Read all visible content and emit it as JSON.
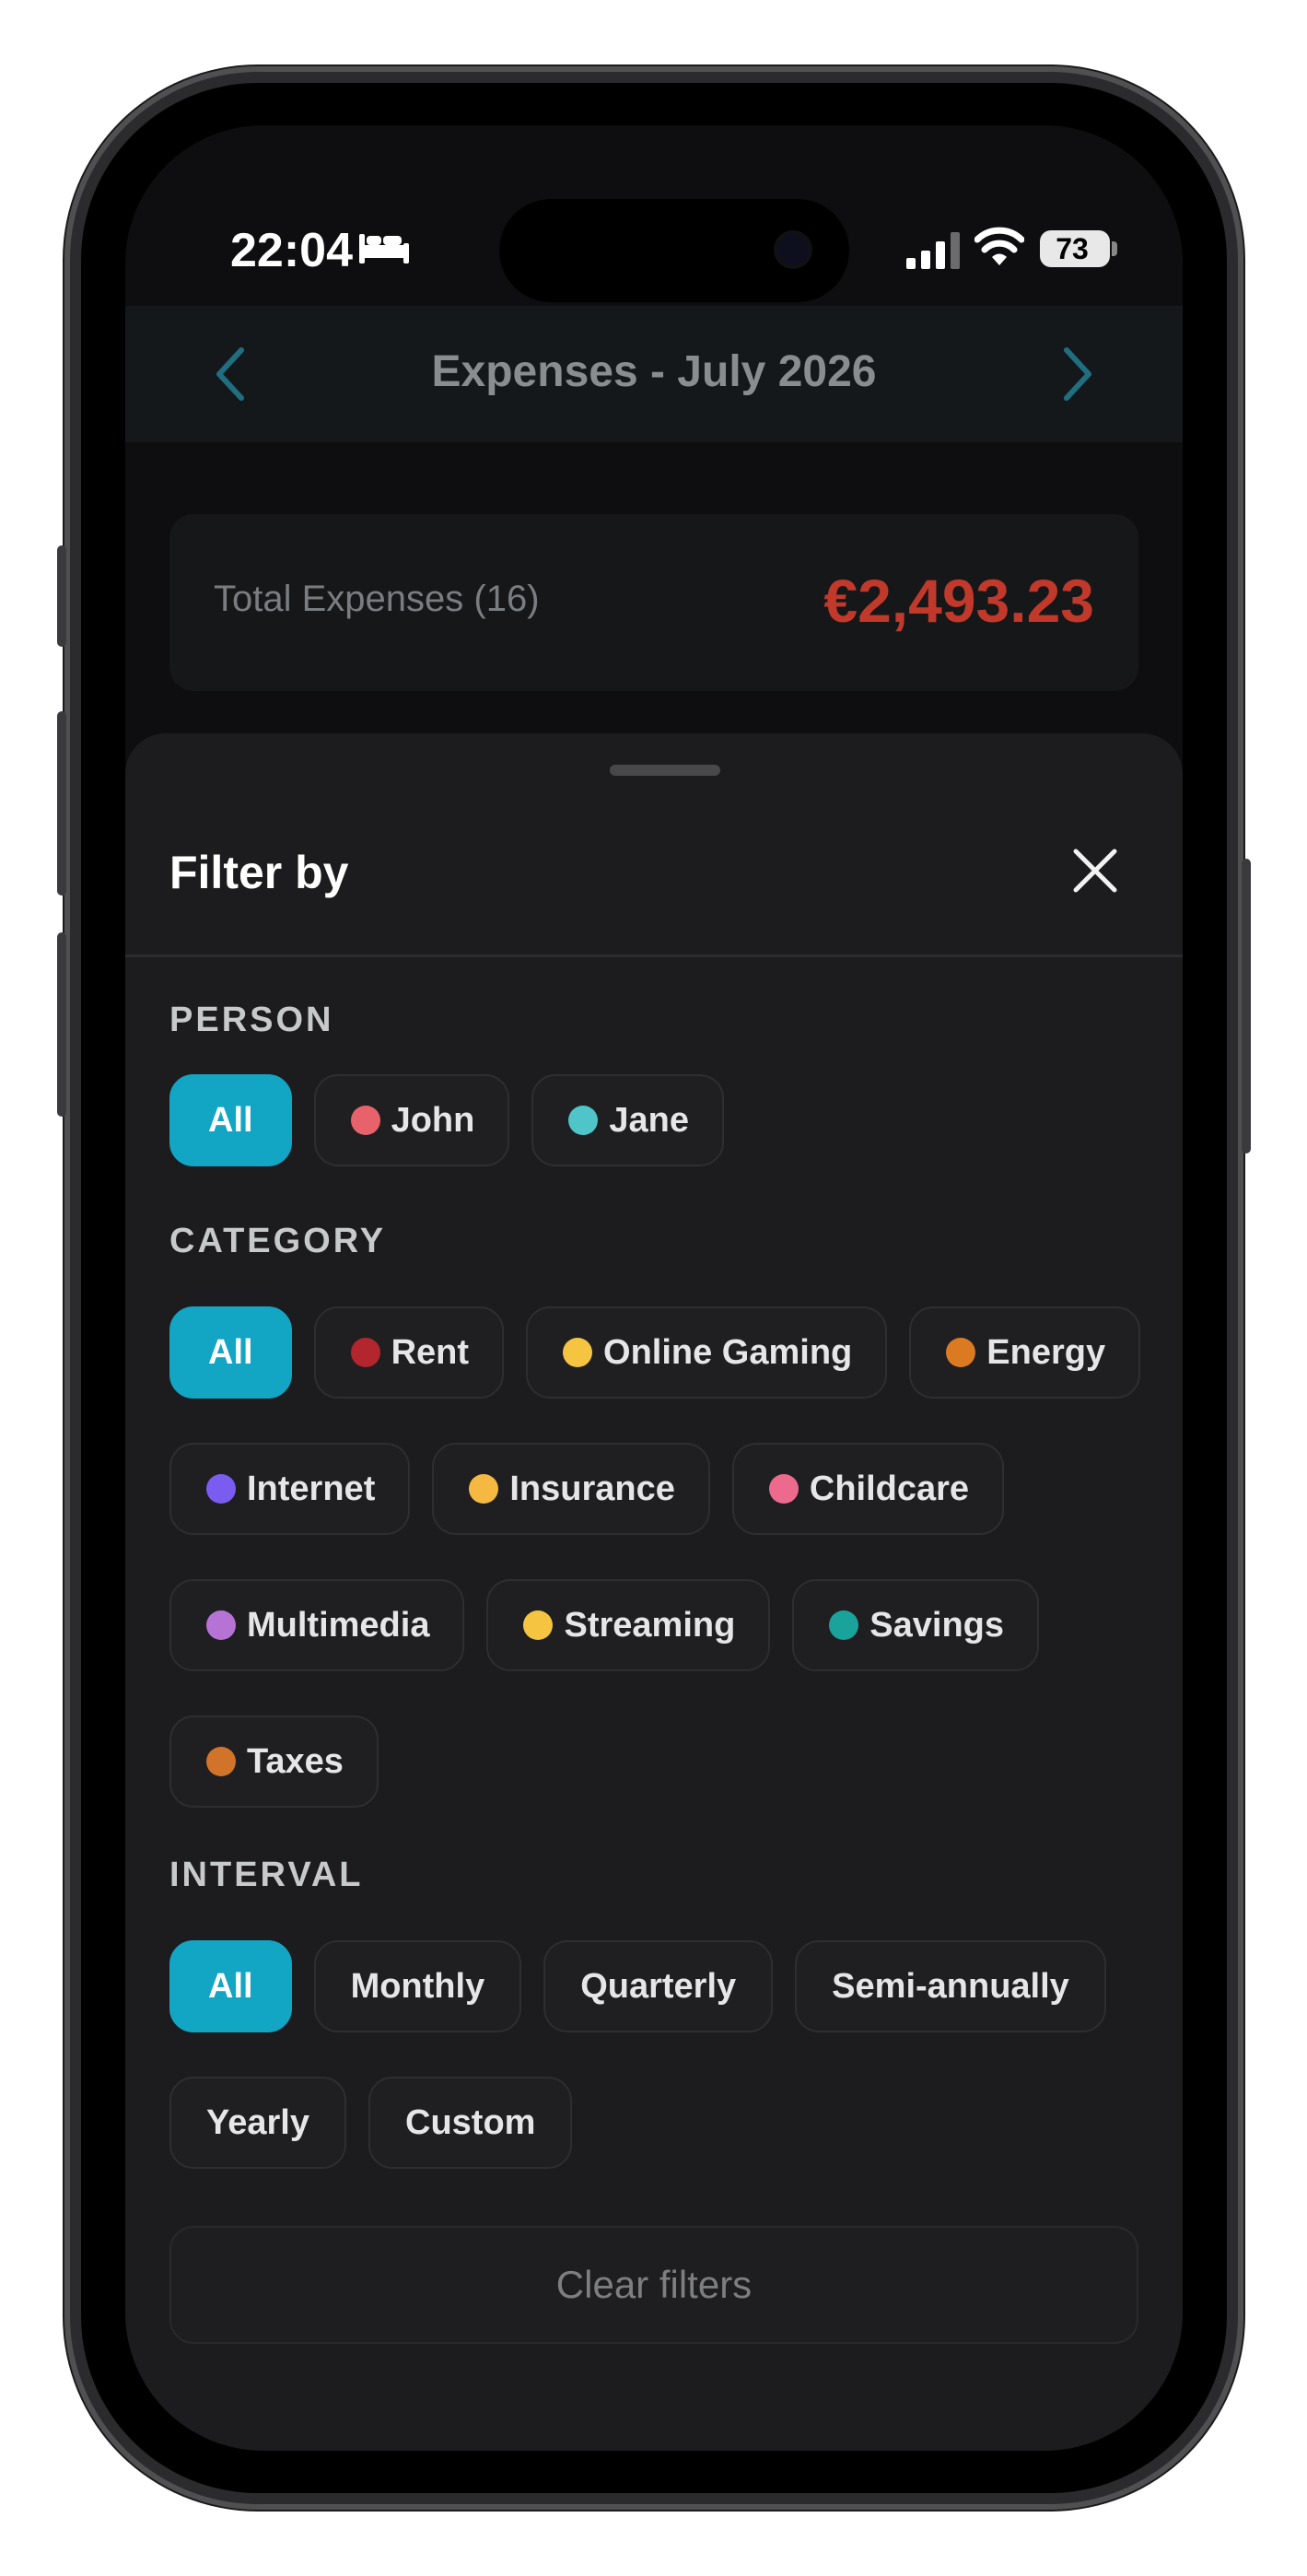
{
  "status_bar": {
    "time": "22:04",
    "battery": "73"
  },
  "header": {
    "title": "Expenses - July 2026"
  },
  "summary": {
    "label": "Total Expenses (16)",
    "value": "€2,493.23",
    "value_color": "#c0392b"
  },
  "sheet": {
    "title": "Filter by",
    "person": {
      "label": "PERSON",
      "options": [
        {
          "label": "All",
          "selected": true
        },
        {
          "label": "John",
          "color": "#e8626b"
        },
        {
          "label": "Jane",
          "color": "#4fc4c9"
        }
      ]
    },
    "category": {
      "label": "CATEGORY",
      "options": [
        {
          "label": "All",
          "selected": true
        },
        {
          "label": "Rent",
          "color": "#b3262d"
        },
        {
          "label": "Online Gaming",
          "color": "#f5c542"
        },
        {
          "label": "Energy",
          "color": "#dc7a22"
        },
        {
          "label": "Internet",
          "color": "#7b5cf0"
        },
        {
          "label": "Insurance",
          "color": "#f5b942"
        },
        {
          "label": "Childcare",
          "color": "#ec6a8e"
        },
        {
          "label": "Multimedia",
          "color": "#b673d6"
        },
        {
          "label": "Streaming",
          "color": "#f5c542"
        },
        {
          "label": "Savings",
          "color": "#1aa39a"
        },
        {
          "label": "Taxes",
          "color": "#d2732a"
        }
      ]
    },
    "interval": {
      "label": "INTERVAL",
      "options": [
        {
          "label": "All",
          "selected": true
        },
        {
          "label": "Monthly"
        },
        {
          "label": "Quarterly"
        },
        {
          "label": "Semi-annually"
        },
        {
          "label": "Yearly"
        },
        {
          "label": "Custom"
        }
      ]
    },
    "clear_label": "Clear filters"
  },
  "colors": {
    "accent": "#13a5c4",
    "sheet_bg": "#1c1c1e"
  }
}
